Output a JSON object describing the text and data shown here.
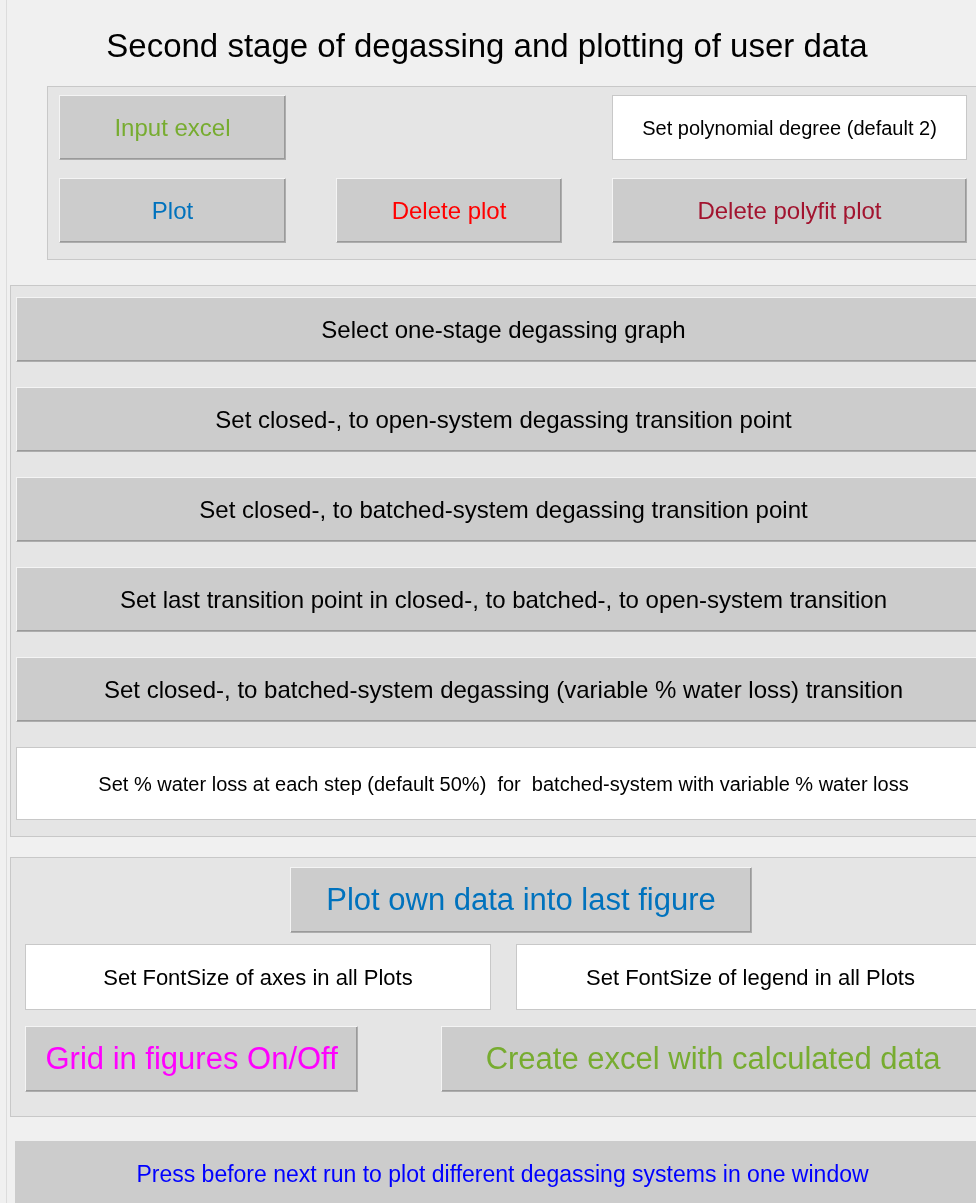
{
  "title": "Second stage of degassing and plotting of user data",
  "top_panel": {
    "rows": [
      [
        {
          "kind": "button",
          "label": "Input excel",
          "color": "#77ac30"
        },
        null,
        {
          "kind": "field",
          "value": "Set polynomial degree (default 2)"
        }
      ],
      [
        {
          "kind": "button",
          "label": "Plot",
          "color": "#0072bd"
        },
        {
          "kind": "button",
          "label": "Delete plot",
          "color": "#ff0000"
        },
        {
          "kind": "button",
          "label": "Delete polyfit plot",
          "color": "#a2142f"
        }
      ]
    ]
  },
  "transition_panel": {
    "items": [
      {
        "kind": "button",
        "label": "Select one-stage degassing graph",
        "color": "#000000"
      },
      {
        "kind": "button",
        "label": "Set closed-, to open-system degassing transition point",
        "color": "#000000"
      },
      {
        "kind": "button",
        "label": "Set closed-, to batched-system degassing transition point",
        "color": "#000000"
      },
      {
        "kind": "button",
        "label": "Set last transition point in closed-, to batched-, to open-system transition",
        "color": "#000000"
      },
      {
        "kind": "button",
        "label": "Set closed-, to batched-system degassing (variable % water loss) transition",
        "color": "#000000"
      },
      {
        "kind": "field",
        "value": "Set % water loss at each step (default 50%)  for  batched-system with variable % water loss"
      }
    ]
  },
  "plot_panel": {
    "main_button": {
      "label": "Plot own data into last figure",
      "color": "#0072bd"
    },
    "fields": [
      {
        "value": "Set FontSize of axes in all Plots"
      },
      {
        "value": "Set FontSize of legend in all Plots"
      }
    ],
    "buttons": [
      {
        "label": "Grid in figures On/Off",
        "color": "#ff00ff"
      },
      {
        "label": "Create excel with calculated data",
        "color": "#77ac30"
      }
    ]
  },
  "bottom_button": {
    "label": "Press before next run to plot different degassing systems in one window",
    "color": "#0000ff"
  }
}
